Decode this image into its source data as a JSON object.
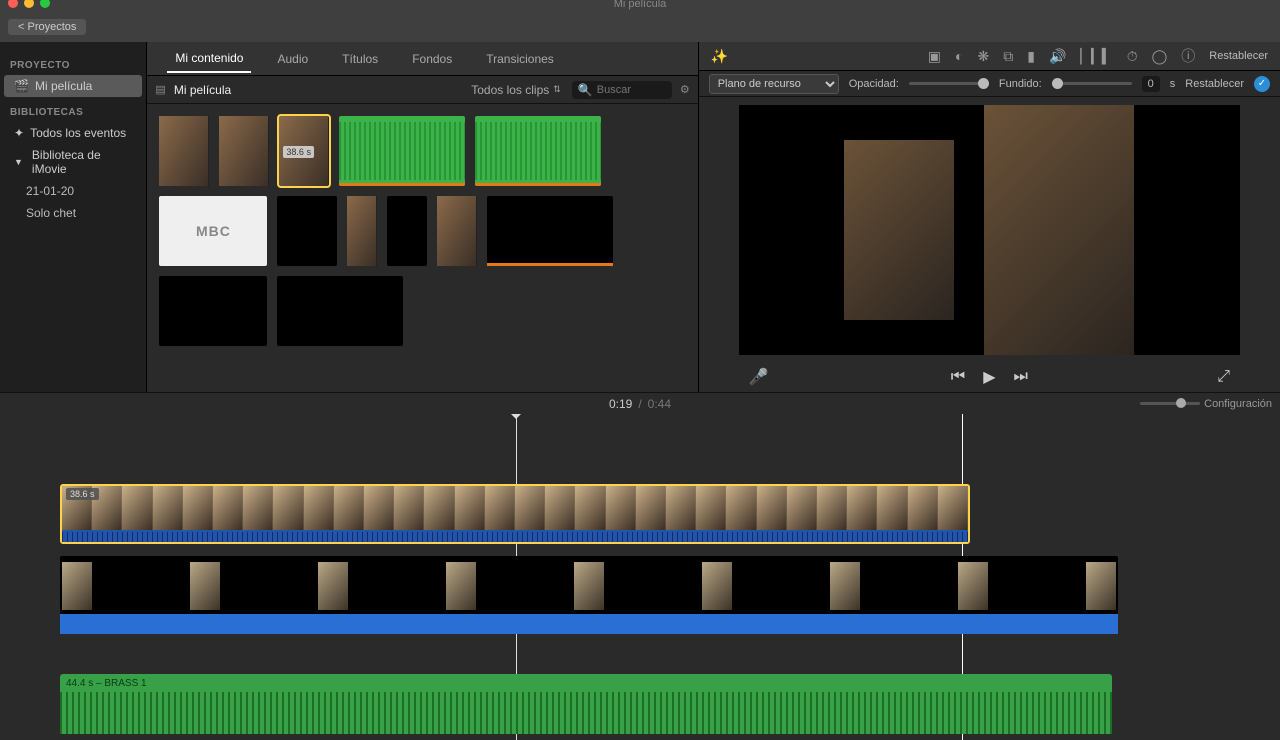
{
  "window_title": "Mi película",
  "traffic": {
    "close": "#ff5f57",
    "min": "#febc2e",
    "max": "#28c840"
  },
  "topbar": {
    "back": "< Proyectos"
  },
  "sidebar": {
    "proj_head": "PROYECTO",
    "proj_item": "Mi película",
    "lib_head": "BIBLIOTECAS",
    "items": [
      "Todos los eventos",
      "Biblioteca de iMovie",
      "21-01-20",
      "Solo chet"
    ]
  },
  "tabs": {
    "content": "Mi contenido",
    "audio": "Audio",
    "titles": "Títulos",
    "backgrounds": "Fondos",
    "transitions": "Transiciones"
  },
  "browse": {
    "project": "Mi película",
    "filter": "Todos los clips",
    "search_ph": "Buscar",
    "sel_badge": "38.6 s"
  },
  "preview": {
    "reset": "Restablecer",
    "overlay_mode": "Plano de recurso",
    "opacity": "Opacidad:",
    "fade": "Fundido:",
    "fade_val": "0",
    "fade_unit": "s",
    "reset2": "Restablecer"
  },
  "time": {
    "current": "0:19",
    "sep": "/",
    "total": "0:44",
    "config": "Configuración"
  },
  "timeline": {
    "pip_dur": "38.6 s",
    "audio_label": "44.4 s – BRASS 1"
  }
}
